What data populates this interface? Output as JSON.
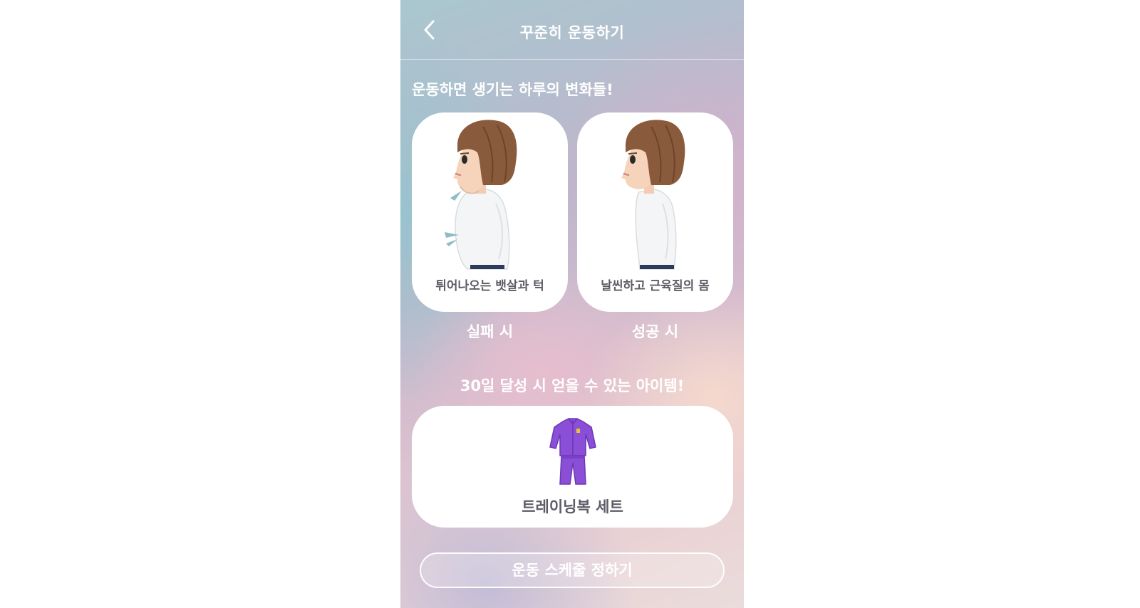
{
  "header": {
    "title": "꾸준히 운동하기",
    "back_icon": "chevron-left-icon"
  },
  "changes": {
    "title": "운동하면 생기는 하루의 변화들!",
    "cards": [
      {
        "caption": "튀어나오는 뱃살과 턱",
        "label": "실패 시"
      },
      {
        "caption": "날씬하고 근육질의 몸",
        "label": "성공 시"
      }
    ]
  },
  "reward": {
    "title": "30일 달성 시 얻을 수 있는 아이템!",
    "item_name": "트레이닝복 세트",
    "item_icon": "tracksuit-icon",
    "item_color": "#8a4fd6"
  },
  "cta": {
    "label": "운동 스케줄 정하기"
  }
}
